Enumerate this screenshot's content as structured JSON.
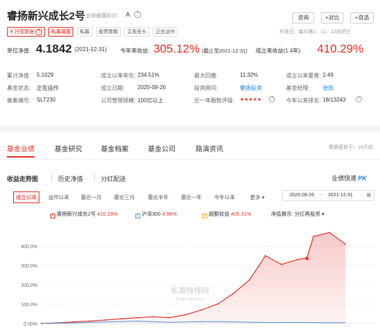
{
  "header": {
    "fund_name": "睿扬新兴成长2号",
    "rating_label": "业绩披露标识：",
    "rating_value": "A",
    "buttons": [
      "咨询",
      "+对比",
      "+自选"
    ],
    "tags": [
      "托管数据",
      "私募募置",
      "私募",
      "股票策略",
      "主观多头",
      "正在运作"
    ],
    "open_day": "开放日：每月第2、12、22自然日"
  },
  "metrics": {
    "nav_label": "单位净值:",
    "nav_value": "4.1842",
    "nav_date": "(2021-12-31)",
    "ytd_label": "今年来收益:",
    "ytd_value": "305.12%",
    "ytd_date": "(截止至2021-12-31)",
    "inception_label": "成立来收益(1.4年):",
    "inception_value": "410.29%"
  },
  "info_rows": [
    [
      [
        "累计净值:",
        "5.1029"
      ],
      [
        "成立以来年化:",
        "234.51%"
      ],
      [
        "最大回撤:",
        "11.32%"
      ],
      [
        "成立以来夏普:",
        "2.49"
      ]
    ],
    [
      [
        "基金状态:",
        "正在运作"
      ],
      [
        "成立日期:",
        "2020-08-26"
      ],
      [
        "投资顾问:",
        "睿扬投资"
      ],
      [
        "基金经理:",
        "张凯"
      ]
    ],
    [
      [
        "备案编号:",
        "SLT230"
      ],
      [
        "公司管理规模:",
        "100亿以上"
      ],
      [
        "近一年融智评级:",
        "★★★★★"
      ],
      [
        "今年以来排名:",
        "18/13243"
      ]
    ]
  ],
  "main_tabs": [
    "基金业绩",
    "基金研究",
    "基金档案",
    "基金公司",
    "路演资讯"
  ],
  "update_note": "数据更新于：19天前",
  "sub_tabs": [
    "收益走势图",
    "历史净值",
    "分红配送"
  ],
  "pk_label": "业绩快速",
  "pk_badge": "PK",
  "ranges": [
    "成立以来",
    "运作以来",
    "最近一月",
    "最近三月",
    "最近半年",
    "最近一年",
    "今年以来",
    "更多"
  ],
  "date_from": "2020-08-26",
  "date_sep": "~",
  "date_to": "2021-12-31",
  "legend": {
    "fund_name": "睿扬新兴成长2号",
    "fund_value": "410.29%",
    "bench_name": "沪深300",
    "bench_value": "4.98%",
    "excess_name": "超额收益",
    "excess_value": "405.31%",
    "display_label": "净值展示:",
    "display_value": "分红再投资"
  },
  "watermark": "私募排排网",
  "watermark_sub": "SIMUWANG",
  "colors": {
    "accent": "#e02e24",
    "bench": "#4a90d9",
    "excess": "#f5a623"
  },
  "chart_data": {
    "type": "area",
    "ylim": [
      0,
      500
    ],
    "yticks": [
      "0.00%",
      "100.0%",
      "200.0%",
      "300.0%",
      "400.0%"
    ],
    "series": [
      {
        "name": "睿扬新兴成长2号",
        "x": [
          0,
          1,
          2,
          3,
          4,
          5,
          6,
          7,
          8,
          9,
          10,
          11,
          12,
          13,
          14,
          15,
          16,
          16.6,
          17,
          18,
          19
        ],
        "values": [
          0,
          3,
          8,
          12,
          18,
          24,
          30,
          35,
          30,
          45,
          70,
          100,
          155,
          225,
          350,
          305,
          330,
          340,
          450,
          470,
          410
        ]
      },
      {
        "name": "沪深300",
        "x": [
          0,
          2,
          4,
          6,
          8,
          10,
          12,
          14,
          16,
          18,
          19
        ],
        "values": [
          0,
          3,
          8,
          12,
          6,
          10,
          8,
          5,
          6,
          4,
          5
        ]
      }
    ]
  }
}
